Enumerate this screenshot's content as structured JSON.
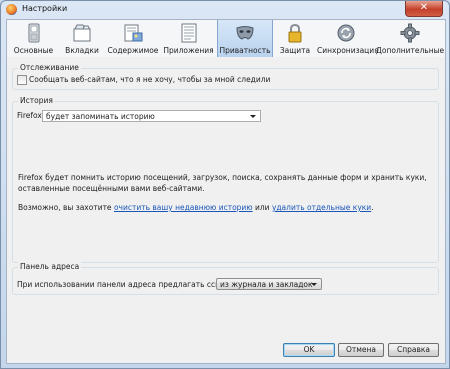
{
  "window": {
    "title": "Настройки",
    "close_glyph": "✕"
  },
  "tabs": [
    {
      "label": "Основные",
      "icon": "general-switch-icon",
      "selected": false
    },
    {
      "label": "Вкладки",
      "icon": "tabs-icon",
      "selected": false
    },
    {
      "label": "Содержимое",
      "icon": "content-icon",
      "selected": false
    },
    {
      "label": "Приложения",
      "icon": "applications-icon",
      "selected": false
    },
    {
      "label": "Приватность",
      "icon": "privacy-mask-icon",
      "selected": true
    },
    {
      "label": "Защита",
      "icon": "padlock-icon",
      "selected": false
    },
    {
      "label": "Синхронизация",
      "icon": "sync-icon",
      "selected": false
    },
    {
      "label": "Дополнительные",
      "icon": "gear-icon",
      "selected": false
    }
  ],
  "tracking": {
    "legend": "Отслеживание",
    "do_not_track_label": "Сообщать веб-сайтам, что я не хочу, чтобы за мной следили",
    "do_not_track_checked": false
  },
  "history": {
    "legend": "История",
    "firefox_label": "Firefox:",
    "mode_value": "будет запоминать историю",
    "description": "Firefox будет помнить историю посещений, загрузок, поиска, сохранять данные форм и хранить куки, оставленные посещёнными вами веб-сайтами.",
    "maybe_text": "Возможно, вы захотите ",
    "clear_history_link": "очистить вашу недавнюю историю",
    "or_text": " или ",
    "remove_cookies_link": "удалить отдельные куки",
    "end_text": "."
  },
  "location_bar": {
    "legend": "Панель адреса",
    "suggest_label": "При использовании панели адреса предлагать ссылки:",
    "suggest_value": "из журнала и закладок"
  },
  "buttons": {
    "ok": "OK",
    "cancel": "Отмена",
    "help": "Справка"
  }
}
